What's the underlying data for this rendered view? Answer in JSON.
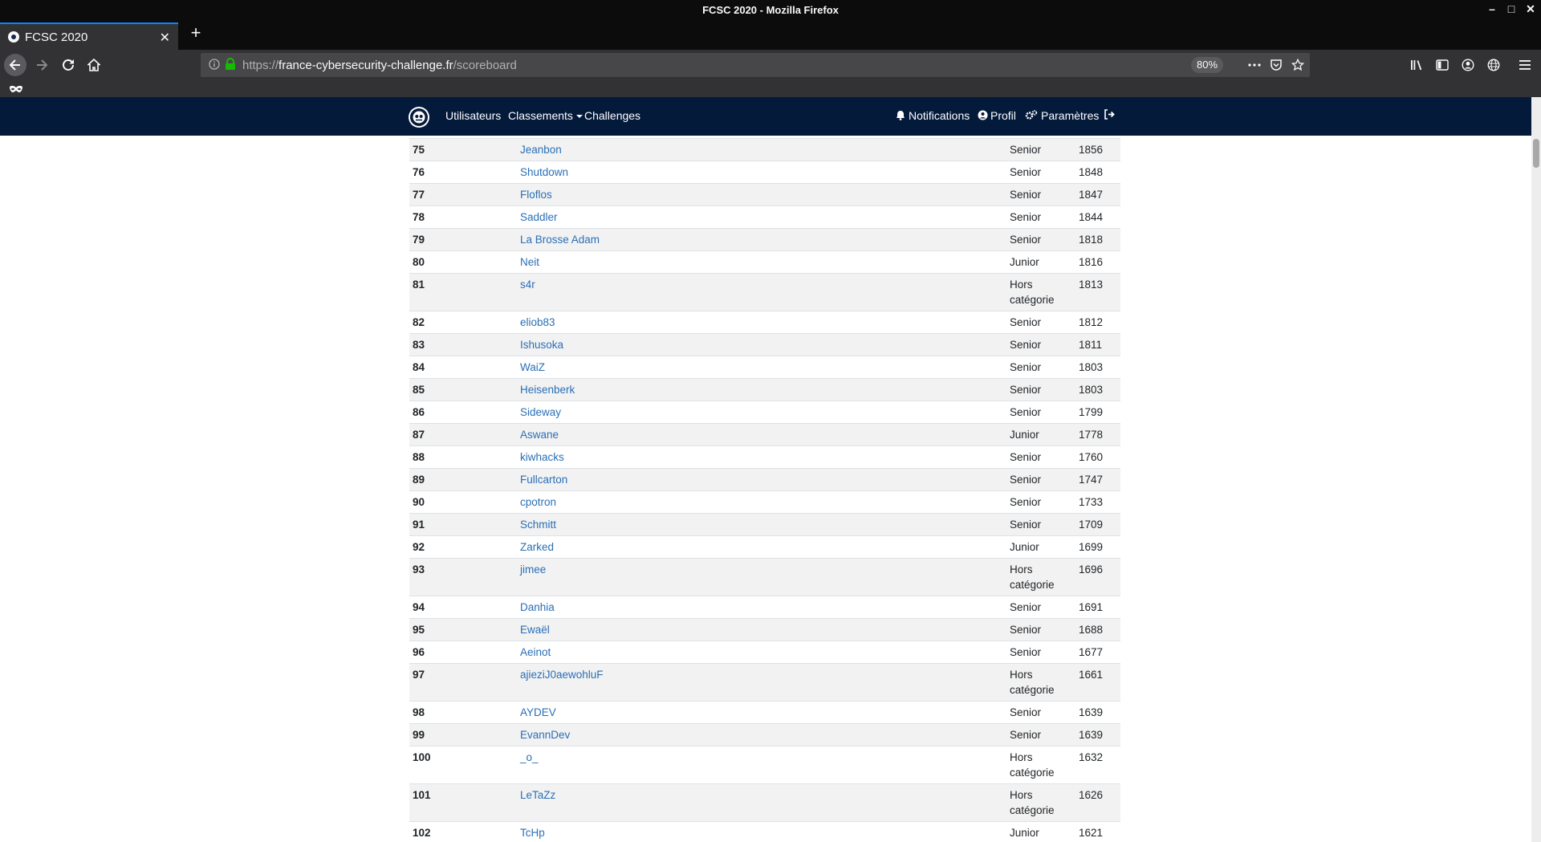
{
  "window": {
    "title": "FCSC 2020 - Mozilla Firefox"
  },
  "tabs": [
    {
      "label": "FCSC 2020",
      "active": true
    }
  ],
  "urlbar": {
    "url_prefix": "https://",
    "url_host": "france-cybersecurity-challenge.fr",
    "url_path": "/scoreboard",
    "zoom": "80%"
  },
  "site_nav": {
    "users": "Utilisateurs",
    "rankings": "Classements",
    "challenges": "Challenges",
    "notifications": "Notifications",
    "profile": "Profil",
    "settings": "Paramètres"
  },
  "scoreboard": {
    "rows": [
      {
        "rank": "75",
        "name": "Jeanbon",
        "category": "Senior",
        "score": "1856"
      },
      {
        "rank": "76",
        "name": "Shutdown",
        "category": "Senior",
        "score": "1848"
      },
      {
        "rank": "77",
        "name": "Floflos",
        "category": "Senior",
        "score": "1847"
      },
      {
        "rank": "78",
        "name": "Saddler",
        "category": "Senior",
        "score": "1844"
      },
      {
        "rank": "79",
        "name": "La Brosse Adam",
        "category": "Senior",
        "score": "1818"
      },
      {
        "rank": "80",
        "name": "Neit",
        "category": "Junior",
        "score": "1816"
      },
      {
        "rank": "81",
        "name": "s4r",
        "category": "Hors catégorie",
        "score": "1813"
      },
      {
        "rank": "82",
        "name": "eliob83",
        "category": "Senior",
        "score": "1812"
      },
      {
        "rank": "83",
        "name": "Ishusoka",
        "category": "Senior",
        "score": "1811"
      },
      {
        "rank": "84",
        "name": "WaiZ",
        "category": "Senior",
        "score": "1803"
      },
      {
        "rank": "85",
        "name": "Heisenberk",
        "category": "Senior",
        "score": "1803"
      },
      {
        "rank": "86",
        "name": "Sideway",
        "category": "Senior",
        "score": "1799"
      },
      {
        "rank": "87",
        "name": "Aswane",
        "category": "Junior",
        "score": "1778"
      },
      {
        "rank": "88",
        "name": "kiwhacks",
        "category": "Senior",
        "score": "1760"
      },
      {
        "rank": "89",
        "name": "Fullcarton",
        "category": "Senior",
        "score": "1747"
      },
      {
        "rank": "90",
        "name": "cpotron",
        "category": "Senior",
        "score": "1733"
      },
      {
        "rank": "91",
        "name": "Schmitt",
        "category": "Senior",
        "score": "1709"
      },
      {
        "rank": "92",
        "name": "Zarked",
        "category": "Junior",
        "score": "1699"
      },
      {
        "rank": "93",
        "name": "jimee",
        "category": "Hors catégorie",
        "score": "1696"
      },
      {
        "rank": "94",
        "name": "Danhia",
        "category": "Senior",
        "score": "1691"
      },
      {
        "rank": "95",
        "name": "Ewaël",
        "category": "Senior",
        "score": "1688"
      },
      {
        "rank": "96",
        "name": "Aeinot",
        "category": "Senior",
        "score": "1677"
      },
      {
        "rank": "97",
        "name": "ajieziJ0aewohluF",
        "category": "Hors catégorie",
        "score": "1661"
      },
      {
        "rank": "98",
        "name": "AYDEV",
        "category": "Senior",
        "score": "1639"
      },
      {
        "rank": "99",
        "name": "EvannDev",
        "category": "Senior",
        "score": "1639"
      },
      {
        "rank": "100",
        "name": "_o_",
        "category": "Hors catégorie",
        "score": "1632"
      },
      {
        "rank": "101",
        "name": "LeTaZz",
        "category": "Hors catégorie",
        "score": "1626"
      },
      {
        "rank": "102",
        "name": "TcHp",
        "category": "Junior",
        "score": "1621"
      }
    ]
  },
  "colors": {
    "site_nav_bg": "#041a3b",
    "link": "#2a6fb6",
    "chrome_dark": "#0c0c0d",
    "chrome_toolbar": "#323234"
  }
}
